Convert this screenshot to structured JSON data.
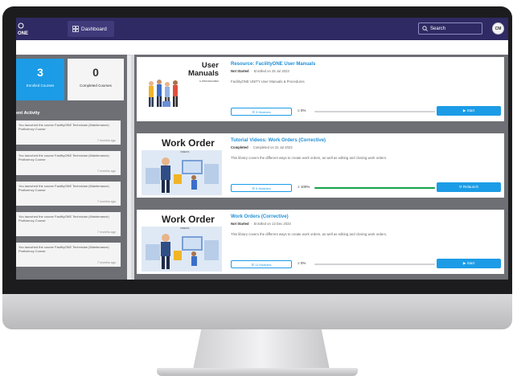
{
  "header": {
    "logo_text": "ONE",
    "dashboard_label": "Dashboard",
    "search_label": "Search",
    "avatar_initials": "CM"
  },
  "stats": {
    "enrolled_count": "3",
    "enrolled_label": "Enrolled Courses",
    "completed_count": "0",
    "completed_label": "Completed Courses"
  },
  "activity": {
    "title": "ent Activity",
    "items": [
      {
        "text": "You launched the course FacilityONE Technician (Maintenance) Proficiency Course",
        "time": "7 months ago"
      },
      {
        "text": "You launched the course FacilityONE Technician (Maintenance) Proficiency Course",
        "time": "7 months ago"
      },
      {
        "text": "You launched the course FacilityONE Technician (Maintenance) Proficiency Course",
        "time": "7 months ago"
      },
      {
        "text": "You launched the course FacilityONE Technician (Maintenance) Proficiency Course",
        "time": "7 months ago"
      },
      {
        "text": "You launched the course FacilityONE Technician (Maintenance) Proficiency Course",
        "time": "7 months ago"
      }
    ]
  },
  "courses": [
    {
      "thumb_title_line1": "User",
      "thumb_title_line2": "Manuals",
      "thumb_sub": "& PROCEDURES",
      "title": "Resource: FacilityONE User Manuals",
      "status": "Not Started",
      "date_text": "Enrolled on 25 Jul 2023",
      "description": "FacilityONE UNITY User Manuals & Procedures",
      "modules": "5 Modules",
      "percent": "0%",
      "progress": 0,
      "action": "Start"
    },
    {
      "thumb_title": "Work Order",
      "thumb_sub": "VIDEOS",
      "title": "Tutorial Videos: Work Orders (Corrective)",
      "status": "Completed",
      "date_text": "Completed on 31 Jul 2023",
      "description": "This library covers the different ways to create work orders, as well as editing and closing work orders.",
      "modules": "5 Modules",
      "percent": "100%",
      "progress": 100,
      "action": "Relaunch"
    },
    {
      "thumb_title": "Work Order",
      "thumb_sub": "VIDEOS",
      "title": "Work Orders (Corrective)",
      "status": "Not Started",
      "date_text": "Enrolled on 13 Dec 2023",
      "description": "This library covers the different ways to create work orders, as well as editing and closing work orders.",
      "modules": "11 Modules",
      "percent": "0%",
      "progress": 0,
      "action": "Start"
    }
  ],
  "colors": {
    "topbar": "#2f2a63",
    "accent": "#1c9ce6",
    "progress_complete": "#17a34a"
  }
}
